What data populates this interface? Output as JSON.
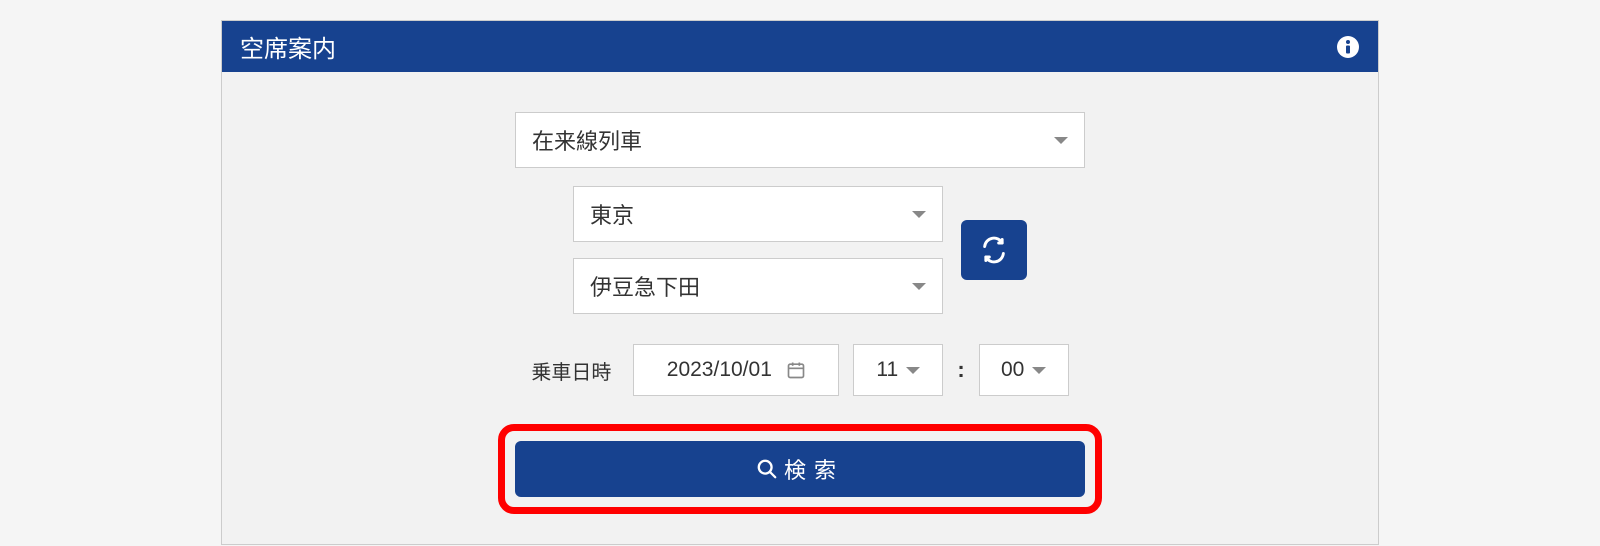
{
  "panel": {
    "title": "空席案内"
  },
  "form": {
    "train_type": "在来線列車",
    "origin_station": "東京",
    "destination_station": "伊豆急下田",
    "datetime_label": "乗車日時",
    "date": "2023/10/01",
    "hour": "11",
    "minute": "00",
    "time_separator": ":"
  },
  "buttons": {
    "search_label": "検索"
  }
}
